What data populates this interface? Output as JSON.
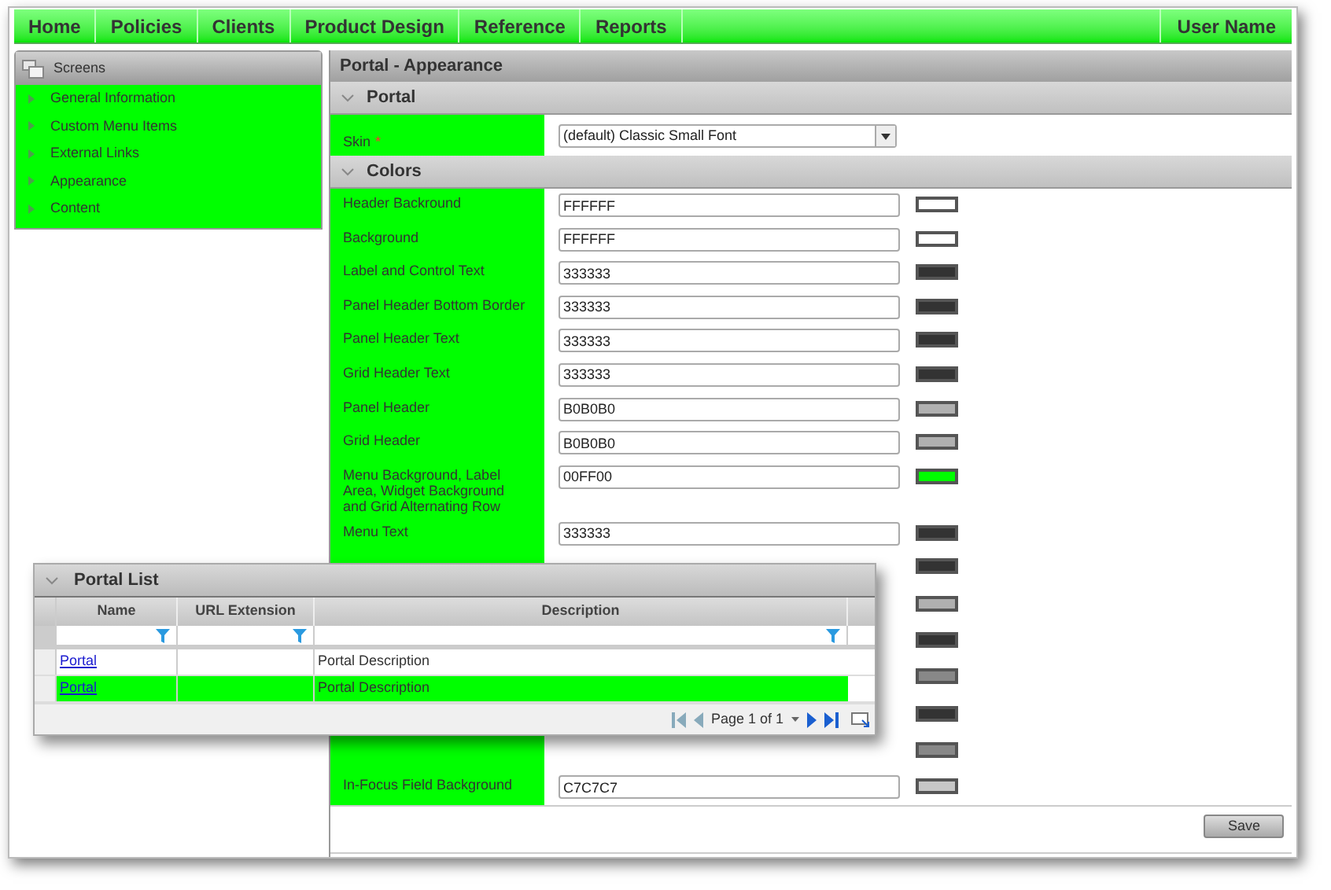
{
  "nav": {
    "items": [
      {
        "label": "Home"
      },
      {
        "label": "Policies"
      },
      {
        "label": "Clients"
      },
      {
        "label": "Product Design"
      },
      {
        "label": "Reference"
      },
      {
        "label": "Reports"
      }
    ],
    "user": "User Name"
  },
  "screens_panel": {
    "title": "Screens",
    "items": [
      {
        "label": "General Information"
      },
      {
        "label": "Custom Menu Items"
      },
      {
        "label": "External Links"
      },
      {
        "label": "Appearance"
      },
      {
        "label": "Content"
      }
    ]
  },
  "main": {
    "title": "Portal - Appearance",
    "sections": [
      {
        "title": "Portal",
        "fields": [
          {
            "kind": "select",
            "label": "Skin",
            "required_mark": "*",
            "value": "(default) Classic Small Font"
          }
        ]
      },
      {
        "title": "Colors",
        "fields": [
          {
            "kind": "color",
            "label": "Header Backround",
            "value": "FFFFFF",
            "color": "#ffffff"
          },
          {
            "kind": "color",
            "label": "Background",
            "value": "FFFFFF",
            "color": "#ffffff"
          },
          {
            "kind": "color",
            "label": "Label and Control Text",
            "value": "333333",
            "color": "#333333"
          },
          {
            "kind": "color",
            "label": "Panel Header Bottom Border",
            "value": "333333",
            "color": "#333333"
          },
          {
            "kind": "color",
            "label": "Panel Header Text",
            "value": "333333",
            "color": "#333333"
          },
          {
            "kind": "color",
            "label": "Grid Header Text",
            "value": "333333",
            "color": "#333333"
          },
          {
            "kind": "color",
            "label": "Panel Header",
            "value": "B0B0B0",
            "color": "#b0b0b0"
          },
          {
            "kind": "color",
            "label": "Grid Header",
            "value": "B0B0B0",
            "color": "#b0b0b0"
          },
          {
            "kind": "color",
            "label": "Menu Background, Label Area, Widget Background and Grid Alternating Row",
            "value": "00FF00",
            "color": "#00ff00"
          },
          {
            "kind": "color",
            "label": "Menu Text",
            "value": "333333",
            "color": "#333333"
          },
          {
            "kind": "covered",
            "color": "#333333"
          },
          {
            "kind": "covered",
            "color": "#b0b0b0"
          },
          {
            "kind": "covered",
            "color": "#333333"
          },
          {
            "kind": "covered",
            "color": "#888888"
          },
          {
            "kind": "covered",
            "color": "#333333"
          },
          {
            "kind": "covered",
            "color": "#888888"
          },
          {
            "kind": "color",
            "label": "In-Focus Field Background",
            "value": "C7C7C7",
            "color": "#c7c7c7"
          }
        ]
      }
    ],
    "save": "Save"
  },
  "portal_list": {
    "title": "Portal List",
    "columns": [
      "Name",
      "URL Extension",
      "Description"
    ],
    "rows": [
      {
        "name": "Portal",
        "description": "Portal Description",
        "selected": false
      },
      {
        "name": "Portal",
        "description": "Portal Description",
        "selected": true
      }
    ],
    "pager": "Page 1 of 1"
  }
}
